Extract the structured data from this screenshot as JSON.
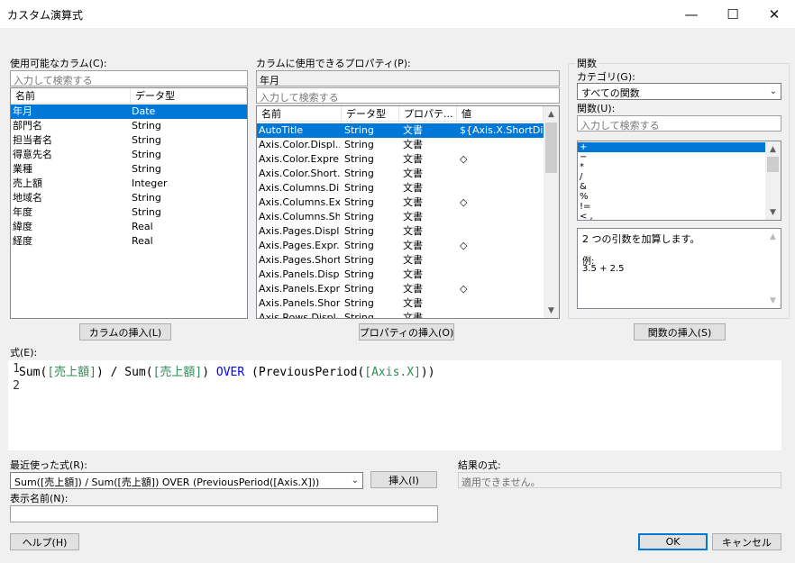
{
  "window": {
    "title": "カスタム演算式",
    "minimize": "—",
    "maximize": "☐",
    "close": "✕"
  },
  "columns_panel": {
    "label": "使用可能なカラム(C):",
    "search_placeholder": "入力して検索する",
    "headers": [
      "名前",
      "データ型"
    ],
    "rows": [
      {
        "name": "年月",
        "type": "Date"
      },
      {
        "name": "部門名",
        "type": "String"
      },
      {
        "name": "担当者名",
        "type": "String"
      },
      {
        "name": "得意先名",
        "type": "String"
      },
      {
        "name": "業種",
        "type": "String"
      },
      {
        "name": "売上額",
        "type": "Integer"
      },
      {
        "name": "地域名",
        "type": "String"
      },
      {
        "name": "年度",
        "type": "String"
      },
      {
        "name": "緯度",
        "type": "Real"
      },
      {
        "name": "経度",
        "type": "Real"
      }
    ],
    "insert_button": "カラムの挿入(L)"
  },
  "properties_panel": {
    "label": "カラムに使用できるプロパティ(P):",
    "current_column": "年月",
    "search_placeholder": "入力して検索する",
    "headers": [
      "名前",
      "データ型",
      "プロパテ...",
      "値"
    ],
    "rows": [
      {
        "name": "AutoTitle",
        "type": "String",
        "prop": "文書",
        "value": "${Axis.X.ShortDi..."
      },
      {
        "name": "Axis.Color.Displ...",
        "type": "String",
        "prop": "文書",
        "value": ""
      },
      {
        "name": "Axis.Color.Expre...",
        "type": "String",
        "prop": "文書",
        "value": "◇"
      },
      {
        "name": "Axis.Color.Short...",
        "type": "String",
        "prop": "文書",
        "value": ""
      },
      {
        "name": "Axis.Columns.Di...",
        "type": "String",
        "prop": "文書",
        "value": ""
      },
      {
        "name": "Axis.Columns.Ex...",
        "type": "String",
        "prop": "文書",
        "value": "◇"
      },
      {
        "name": "Axis.Columns.Sh...",
        "type": "String",
        "prop": "文書",
        "value": ""
      },
      {
        "name": "Axis.Pages.Displ...",
        "type": "String",
        "prop": "文書",
        "value": ""
      },
      {
        "name": "Axis.Pages.Expr...",
        "type": "String",
        "prop": "文書",
        "value": "◇"
      },
      {
        "name": "Axis.Pages.Short...",
        "type": "String",
        "prop": "文書",
        "value": ""
      },
      {
        "name": "Axis.Panels.Disp...",
        "type": "String",
        "prop": "文書",
        "value": ""
      },
      {
        "name": "Axis.Panels.Expr...",
        "type": "String",
        "prop": "文書",
        "value": "◇"
      },
      {
        "name": "Axis.Panels.Shor...",
        "type": "String",
        "prop": "文書",
        "value": ""
      },
      {
        "name": "Axis.Rows.Displ...",
        "type": "String",
        "prop": "文書",
        "value": ""
      }
    ],
    "insert_button": "プロパティの挿入(O)"
  },
  "functions_panel": {
    "group_label": "関数",
    "category_label": "カテゴリ(G):",
    "category_value": "すべての関数",
    "function_label": "関数(U):",
    "search_placeholder": "入力して検索する",
    "items": [
      "+",
      "−",
      "*",
      "/",
      "&",
      "%",
      "!=",
      "<  ,"
    ],
    "description": "2 つの引数を加算します。",
    "example_label": "例:",
    "example_value": "3.5 + 2.5",
    "insert_button": "関数の挿入(S)"
  },
  "expression": {
    "label": "式(E):",
    "line1_num": "1",
    "line2_num": "2",
    "tokens": [
      {
        "t": "Sum(",
        "c": "fn"
      },
      {
        "t": "[売上額]",
        "c": "col"
      },
      {
        "t": ") / ",
        "c": "fn"
      },
      {
        "t": "Sum(",
        "c": "fn"
      },
      {
        "t": "[売上額]",
        "c": "col"
      },
      {
        "t": ") ",
        "c": "fn"
      },
      {
        "t": "OVER",
        "c": "kw"
      },
      {
        "t": " (PreviousPeriod(",
        "c": "fn"
      },
      {
        "t": "[Axis.X]",
        "c": "col"
      },
      {
        "t": "))",
        "c": "fn"
      }
    ]
  },
  "recent": {
    "label": "最近使った式(R):",
    "value": "Sum([売上額]) / Sum([売上額]) OVER (PreviousPeriod([Axis.X]))",
    "insert_button": "挿入(I)"
  },
  "result": {
    "label": "結果の式:",
    "value": "適用できません。"
  },
  "display_name": {
    "label": "表示名前(N):",
    "value": ""
  },
  "footer": {
    "help": "ヘルプ(H)",
    "ok": "OK",
    "cancel": "キャンセル"
  },
  "colors": {
    "accent": "#0078d7",
    "column_color": "#2e8b57",
    "keyword_color": "#0000ff"
  }
}
